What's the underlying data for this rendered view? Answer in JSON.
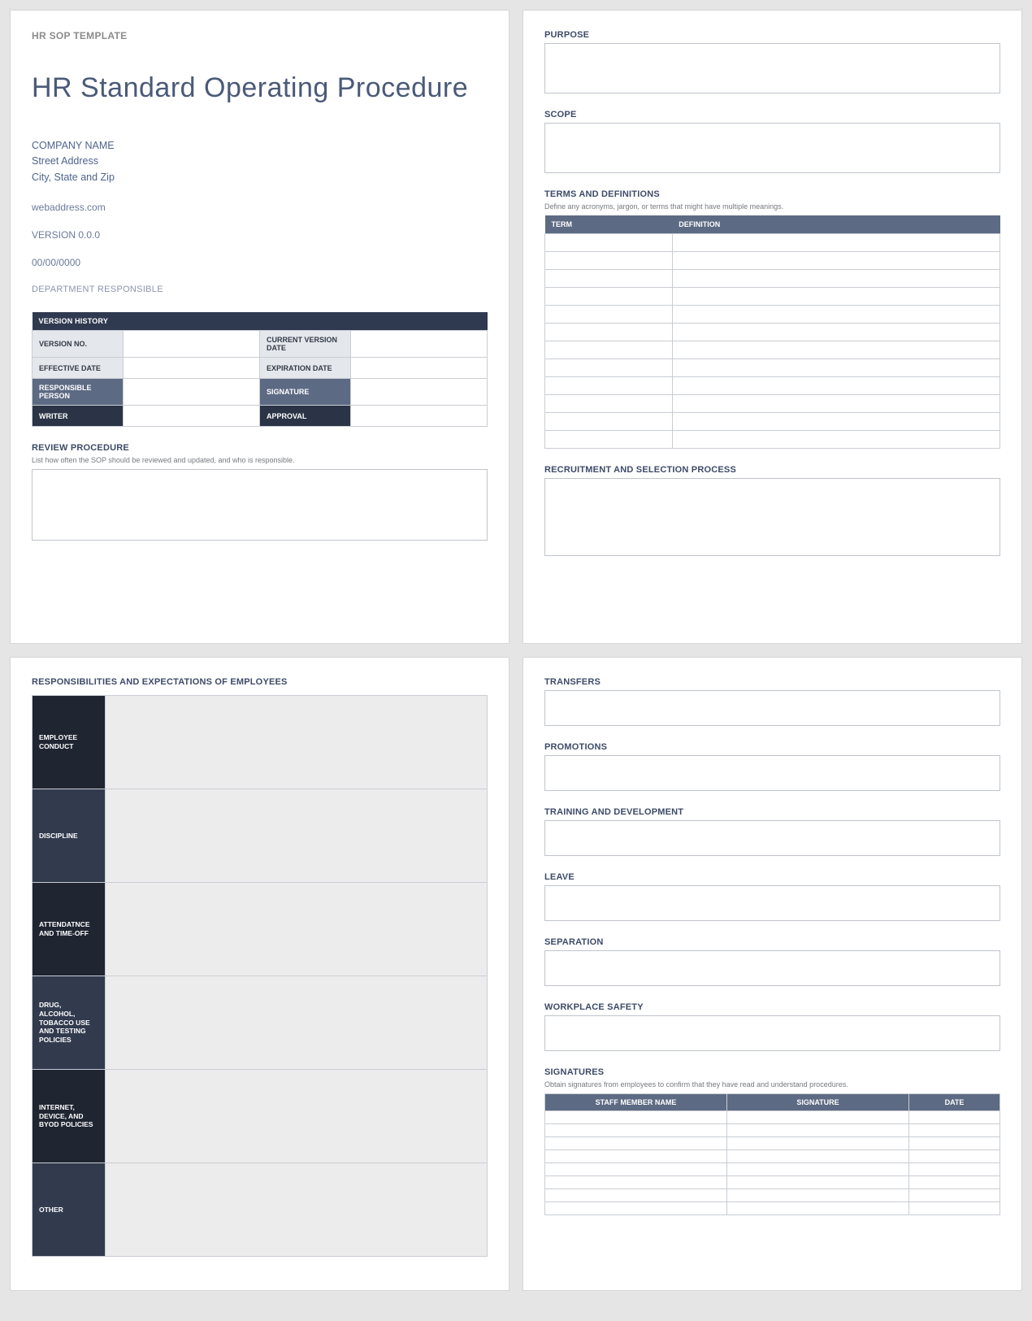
{
  "template_name": "HR SOP TEMPLATE",
  "doc_title": "HR Standard Operating Procedure",
  "company": {
    "name": "COMPANY NAME",
    "street": "Street Address",
    "city_state_zip": "City, State and Zip"
  },
  "web": "webaddress.com",
  "version_line": "VERSION 0.0.0",
  "date_line": "00/00/0000",
  "dept_line": "DEPARTMENT RESPONSIBLE",
  "version_history": {
    "title": "VERSION HISTORY",
    "rows": [
      {
        "l1": "VERSION NO.",
        "l2": "CURRENT VERSION DATE"
      },
      {
        "l1": "EFFECTIVE DATE",
        "l2": "EXPIRATION DATE"
      },
      {
        "l1": "RESPONSIBLE PERSON",
        "l2": "SIGNATURE"
      },
      {
        "l1": "WRITER",
        "l2": "APPROVAL"
      }
    ]
  },
  "review": {
    "title": "REVIEW PROCEDURE",
    "sub": "List how often the SOP should be reviewed and updated, and who is responsible."
  },
  "purpose": {
    "title": "PURPOSE"
  },
  "scope": {
    "title": "SCOPE"
  },
  "terms": {
    "title": "TERMS AND DEFINITIONS",
    "sub": "Define any acronyms, jargon, or terms that might have multiple meanings.",
    "col1": "TERM",
    "col2": "DEFINITION",
    "row_count": 12
  },
  "recruitment": {
    "title": "RECRUITMENT AND SELECTION PROCESS"
  },
  "responsibilities": {
    "title": "RESPONSIBILITIES AND EXPECTATIONS OF EMPLOYEES",
    "rows": [
      "EMPLOYEE CONDUCT",
      "DISCIPLINE",
      "ATTENDATNCE AND TIME-OFF",
      "DRUG, ALCOHOL, TOBACCO USE AND TESTING POLICIES",
      "INTERNET, DEVICE, AND BYOD POLICIES",
      "OTHER"
    ]
  },
  "transfers": {
    "title": "TRANSFERS"
  },
  "promotions": {
    "title": "PROMOTIONS"
  },
  "training": {
    "title": "TRAINING AND DEVELOPMENT"
  },
  "leave": {
    "title": "LEAVE"
  },
  "separation": {
    "title": "SEPARATION"
  },
  "safety": {
    "title": "WORKPLACE SAFETY"
  },
  "signatures": {
    "title": "SIGNATURES",
    "sub": "Obtain signatures from employees to confirm that they have read and understand procedures.",
    "col1": "STAFF MEMBER NAME",
    "col2": "SIGNATURE",
    "col3": "DATE",
    "row_count": 8
  }
}
